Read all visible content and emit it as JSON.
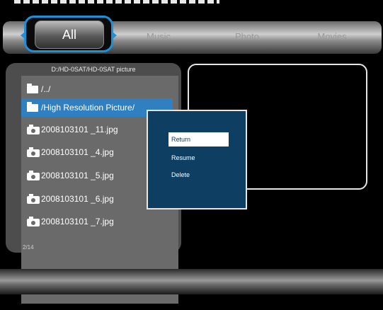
{
  "tabs": [
    {
      "label": "All",
      "selected": true
    },
    {
      "label": "Music"
    },
    {
      "label": "Photo"
    },
    {
      "label": "Movies"
    }
  ],
  "browser": {
    "path": "D:/HD-0SAT/HD-0SAT picture",
    "items": [
      {
        "type": "folder",
        "name": "/../"
      },
      {
        "type": "folder",
        "name": "/High Resolution Picture/",
        "selected": true
      },
      {
        "type": "image",
        "name": "2008103101 _11.jpg"
      },
      {
        "type": "image",
        "name": "2008103101 _4.jpg"
      },
      {
        "type": "image",
        "name": "2008103101 _5.jpg"
      },
      {
        "type": "image",
        "name": "2008103101 _6.jpg"
      },
      {
        "type": "image",
        "name": "2008103101 _7.jpg"
      }
    ],
    "page_count": "2/14"
  },
  "context_menu": {
    "items": [
      {
        "label": "Return",
        "active": true
      },
      {
        "label": "Resume"
      },
      {
        "label": "Delete"
      }
    ]
  },
  "colors": {
    "accent": "#1e90d8",
    "selection": "#2f7fc1",
    "menu_bg": "#0e3f62"
  }
}
